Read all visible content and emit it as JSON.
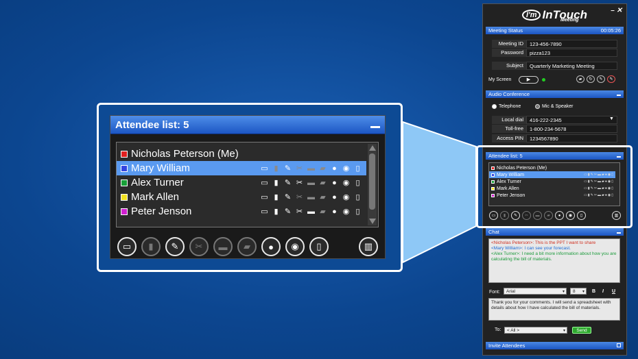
{
  "colors": {
    "background": "#0d4a94",
    "header_blue": "#1c56c4",
    "selected_row": "#5a9af0",
    "callout": "#8ec8f6"
  },
  "zoom": {
    "title": "Attendee list: 5",
    "attendees": [
      {
        "name": "Nicholas Peterson (Me)",
        "color": "#e02020",
        "selected": false,
        "icons": []
      },
      {
        "name": "Mary William",
        "color": "#3344e0",
        "selected": true,
        "icons": [
          "monitor-icon",
          "mouse-icon",
          "pencil-icon",
          "scissors-icon",
          "printer-icon",
          "folder-icon",
          "users-icon",
          "chat-icon",
          "microphone-icon"
        ]
      },
      {
        "name": "Alex Turner",
        "color": "#18a038",
        "selected": false,
        "icons": [
          "monitor-icon",
          "mouse-icon",
          "pencil-icon",
          "scissors-icon",
          "printer-icon",
          "folder-icon",
          "users-icon",
          "chat-icon",
          "microphone-icon"
        ]
      },
      {
        "name": "Mark Allen",
        "color": "#f0e020",
        "selected": false,
        "icons": [
          "monitor-icon",
          "mouse-icon",
          "pencil-icon",
          "scissors-icon",
          "printer-icon",
          "folder-icon",
          "users-icon",
          "chat-icon",
          "microphone-icon"
        ]
      },
      {
        "name": "Peter Jenson",
        "color": "#d020d0",
        "selected": false,
        "icons": [
          "monitor-icon",
          "mouse-icon",
          "pencil-icon",
          "scissors-icon",
          "printer-icon",
          "folder-icon",
          "users-icon",
          "chat-icon",
          "microphone-icon"
        ]
      }
    ],
    "toolbar": [
      "monitor-icon",
      "mouse-icon",
      "pencil-icon",
      "scissors-icon",
      "printer-icon",
      "folder-icon",
      "users-icon",
      "chat-icon",
      "microphone-icon",
      "trash-icon"
    ]
  },
  "app": {
    "logo_badge": "I'm",
    "logo_text": "InTouch",
    "logo_sub": "Meeting",
    "window_controls": "–  ✕",
    "meeting_status": {
      "title": "Meeting Status",
      "timer": "00:05:26",
      "meeting_id_label": "Meeting ID",
      "meeting_id": "123-456-7890",
      "password_label": "Password",
      "password": "pizza123",
      "subject_label": "Subject",
      "subject": "Quarterly Marketing Meeting",
      "my_screen_label": "My Screen",
      "play_glyph": "▶"
    },
    "audio": {
      "title": "Audio Conference",
      "telephone": "Telephone",
      "mic_speaker": "Mic & Speaker",
      "local_dial_label": "Local dial",
      "local_dial": "416-222-2345",
      "toll_free_label": "Toll-free",
      "toll_free": "1-800-234-5678",
      "pin_label": "Access PIN",
      "pin": "1234567890"
    },
    "attendee_title": "Attendee list: 5",
    "chat": {
      "title": "Chat",
      "line1": "<Nicholas Peterson>: This is the PPT I want to share",
      "line2": "<Mary William>: I can see your forecast.",
      "line3": "<Alex Turner>: I need a bit more information about how you are calculating the bill of materials.",
      "font_label": "Font:",
      "font_value": "Arial",
      "size_value": "8",
      "bold": "B",
      "italic": "I",
      "underline": "U",
      "draft": "Thank you for your comments.  I will send a spreadsheet with details about how I have calculated the bill of materials.",
      "to_label": "To:",
      "to_value": "< All >",
      "send_label": "Send"
    },
    "invite_title": "Invite Attendees"
  }
}
